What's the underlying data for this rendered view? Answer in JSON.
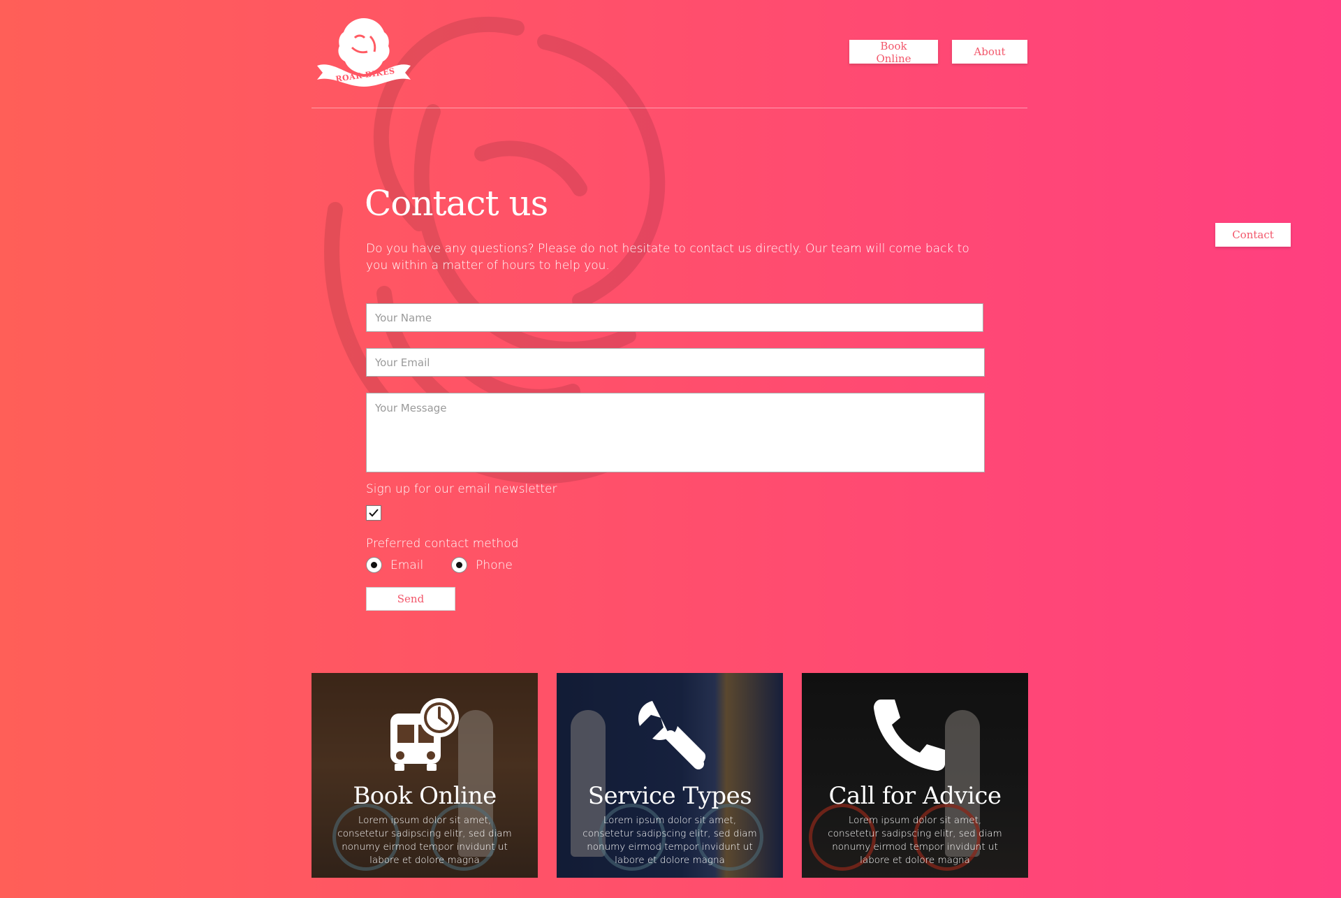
{
  "brand": {
    "logo_alt": "ROAR BIKES",
    "logo_text": "ROAR BIKES"
  },
  "nav": {
    "items": [
      {
        "label": "Book Online"
      },
      {
        "label": "About"
      },
      {
        "label": "Contact"
      }
    ]
  },
  "contact": {
    "title": "Contact us",
    "intro": "Do you have any questions? Please do not hesitate to contact us directly. Our team will come back to you within a matter of hours to help you.",
    "name_placeholder": "Your Name",
    "email_placeholder": "Your Email",
    "message_placeholder": "Your Message",
    "newsletter_label": "Sign up for our email newsletter",
    "newsletter_checked": true,
    "method_label": "Preferred contact method",
    "methods": [
      {
        "label": "Email",
        "selected": true
      },
      {
        "label": "Phone",
        "selected": true
      }
    ],
    "send_label": "Send"
  },
  "cards": [
    {
      "title": "Book Online",
      "text": "Lorem ipsum dolor sit amet, consetetur sadipscing elitr, sed diam nonumy eirmod tempor invidunt ut labore et dolore magna",
      "icon": "bus-clock-icon"
    },
    {
      "title": "Service Types",
      "text": "Lorem ipsum dolor sit amet, consetetur sadipscing elitr, sed diam nonumy eirmod tempor invidunt ut labore et dolore magna",
      "icon": "wrench-icon"
    },
    {
      "title": "Call for Advice",
      "text": "Lorem ipsum dolor sit amet, consetetur sadipscing elitr, sed diam nonumy eirmod tempor invidunt ut labore et dolore magna",
      "icon": "phone-icon"
    }
  ],
  "colors": {
    "accent": "#f2566a",
    "gradient_start": "#ff5f58",
    "gradient_end": "#ff3f80"
  }
}
